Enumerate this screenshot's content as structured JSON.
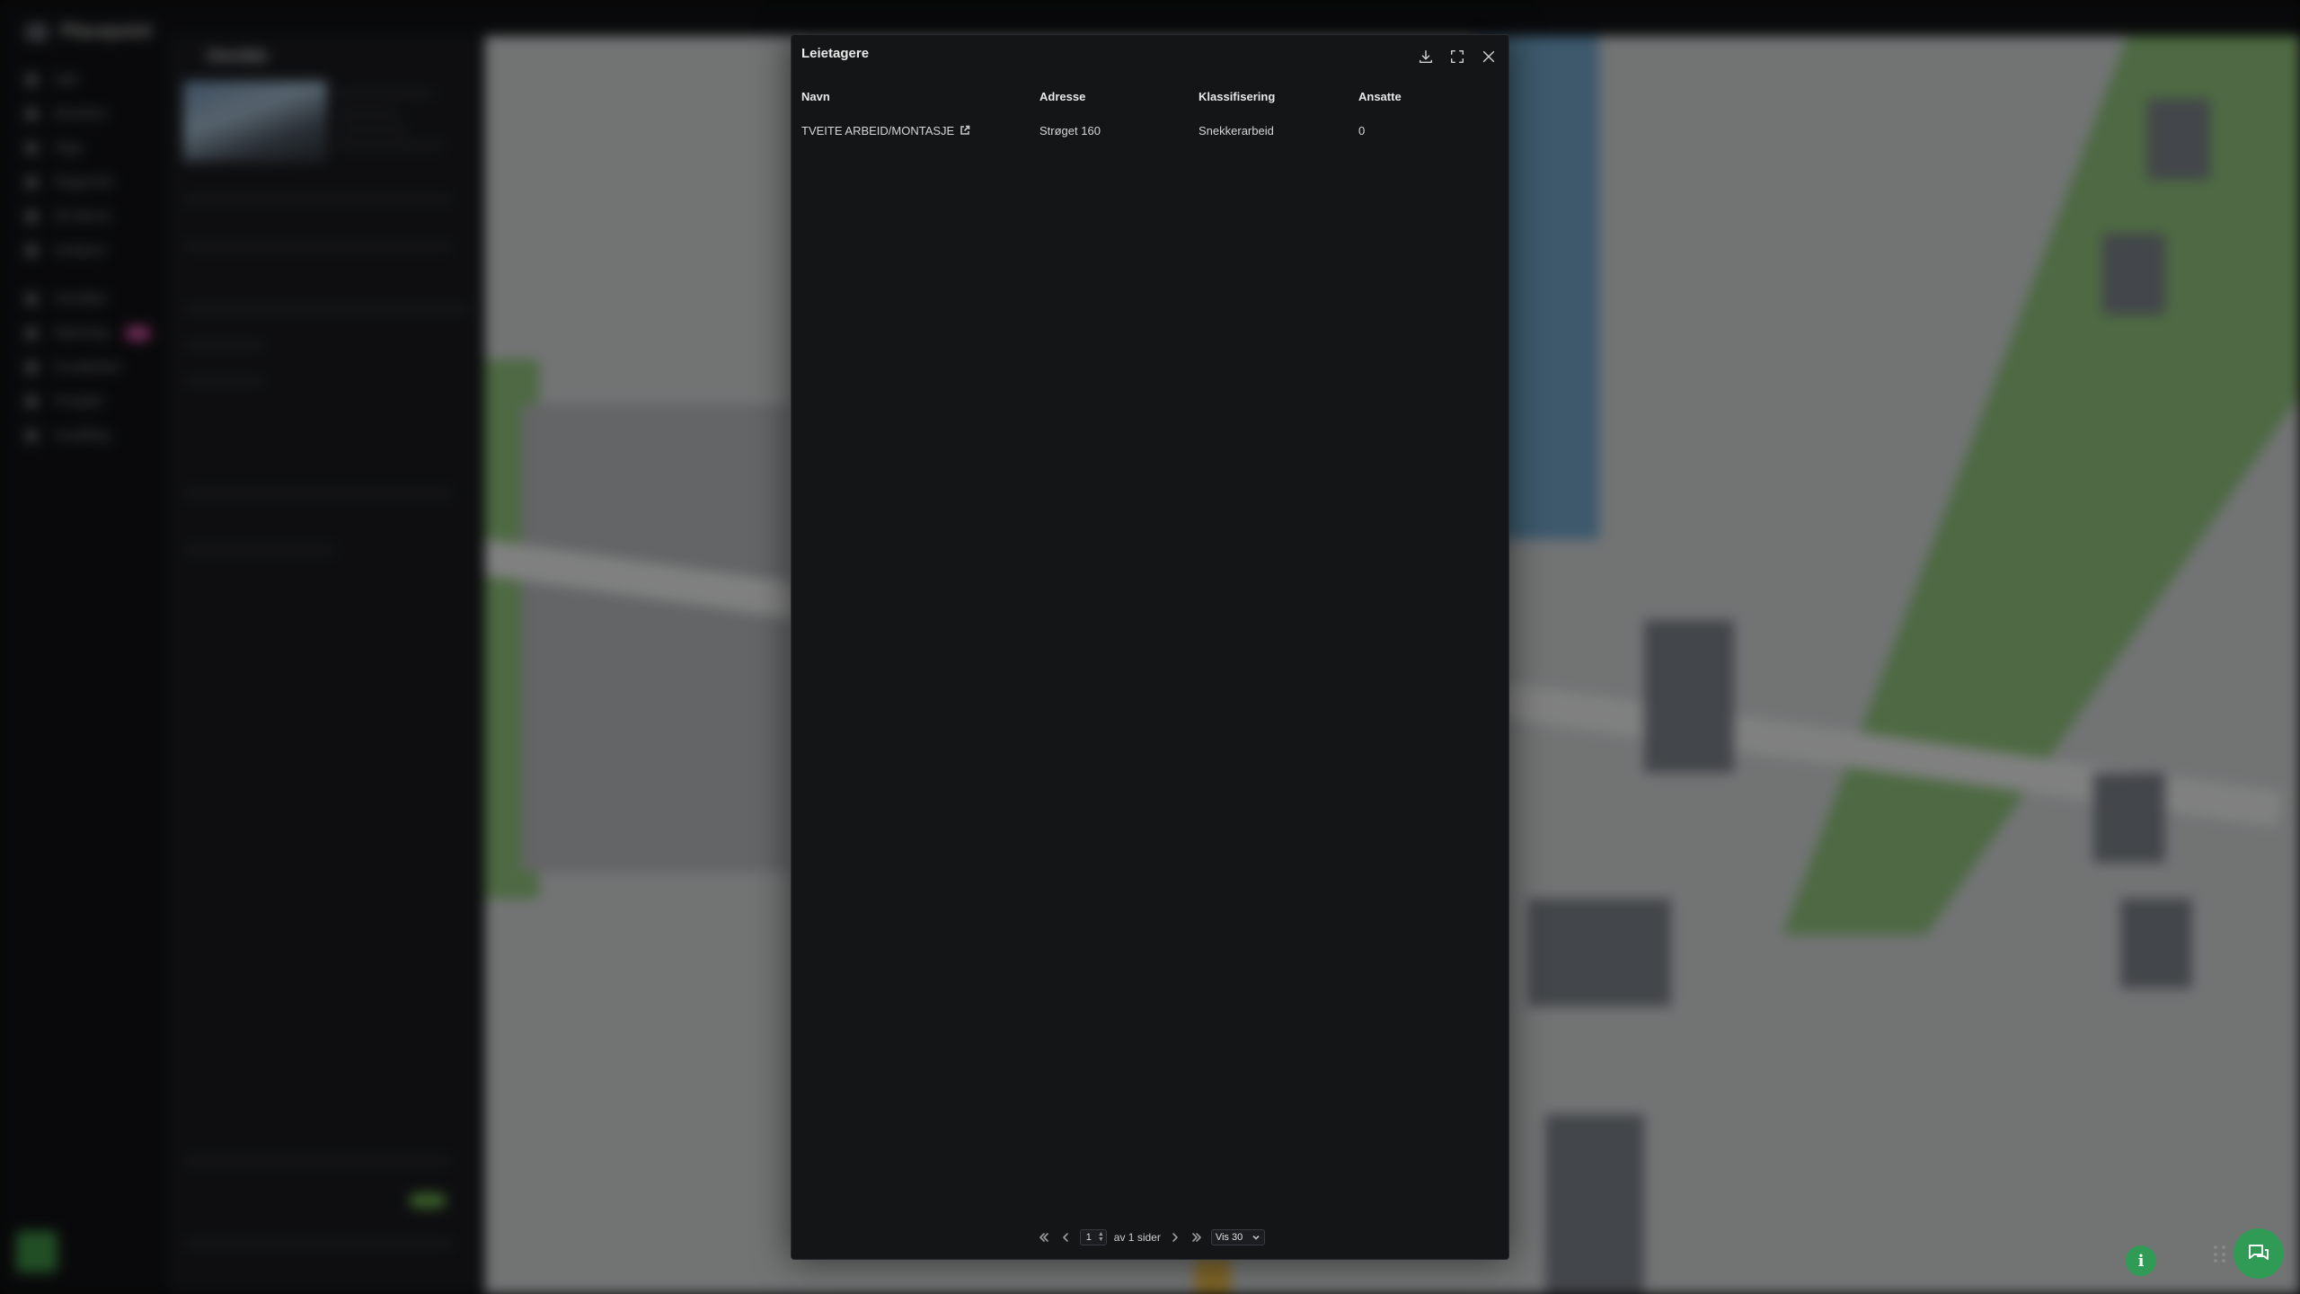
{
  "background": {
    "brand": "Placepoint",
    "nav_items": [
      "Søk",
      "Eiendom",
      "Tegn",
      "Rapporter",
      "3D-tårnet",
      "Analyser",
      "Områder",
      "Matching",
      "Kundelister",
      "Prosjekt",
      "Innstilling"
    ],
    "nav_badge": "Ny",
    "panel_title": "Område"
  },
  "modal": {
    "title": "Leietagere",
    "actions": {
      "download": "download-icon",
      "fullscreen": "fullscreen-icon",
      "close": "close-icon"
    },
    "columns": [
      "Navn",
      "Adresse",
      "Klassifisering",
      "Ansatte"
    ],
    "rows": [
      {
        "navn": "TVEITE ARBEID/MONTASJE",
        "adresse": "Strøget 160",
        "klassifisering": "Snekkerarbeid",
        "ansatte": "0"
      }
    ],
    "pager": {
      "current_page": "1",
      "of_pages": "av 1 sider",
      "page_size": "Vis 30"
    }
  },
  "colors": {
    "modal_bg": "#141517",
    "accent_green": "#2f9b55",
    "map_blue": "#6fa2c4",
    "map_green": "#8ec07a"
  }
}
